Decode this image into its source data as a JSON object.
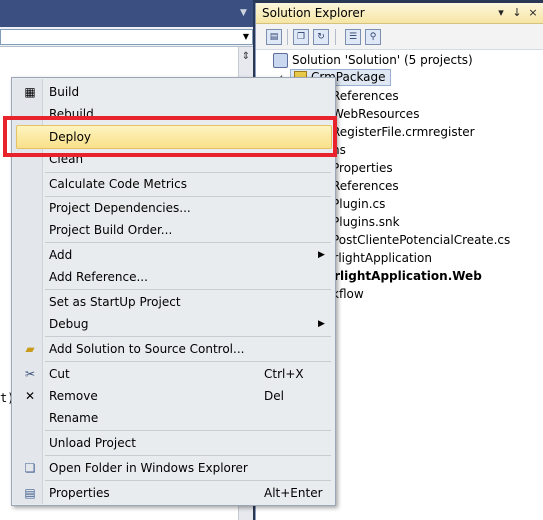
{
  "editor": {
    "code_fragment": "t)"
  },
  "solution_explorer": {
    "title": "Solution Explorer",
    "pin_glyph": "↓",
    "close_glyph": "×",
    "dropdown_glyph": "▾",
    "solution_label": "Solution 'Solution' (5 projects)",
    "selected_project": "CrmPackage",
    "tree_items": [
      "References",
      "WebResources",
      "RegisterFile.crmregister",
      "ns",
      "Properties",
      "References",
      "Plugin.cs",
      "Plugins.snk",
      "PostClientePotencialCreate.cs",
      "erlightApplication",
      "erlightApplication.Web",
      "kflow"
    ]
  },
  "context_menu": {
    "build": "Build",
    "rebuild": "Rebuild",
    "deploy": "Deploy",
    "clean": "Clean",
    "calc_metrics": "Calculate Code Metrics",
    "project_dependencies": "Project Dependencies...",
    "project_build_order": "Project Build Order...",
    "add": "Add",
    "add_reference": "Add Reference...",
    "set_startup": "Set as StartUp Project",
    "debug": "Debug",
    "add_source_control": "Add Solution to Source Control...",
    "cut": "Cut",
    "cut_shortcut": "Ctrl+X",
    "remove": "Remove",
    "remove_shortcut": "Del",
    "rename": "Rename",
    "unload_project": "Unload Project",
    "open_folder": "Open Folder in Windows Explorer",
    "properties": "Properties",
    "properties_shortcut": "Alt+Enter"
  },
  "colors": {
    "highlight_border": "#e8232b",
    "menu_hover": "#f9e08a",
    "title_bar": "#f6e6a4"
  }
}
